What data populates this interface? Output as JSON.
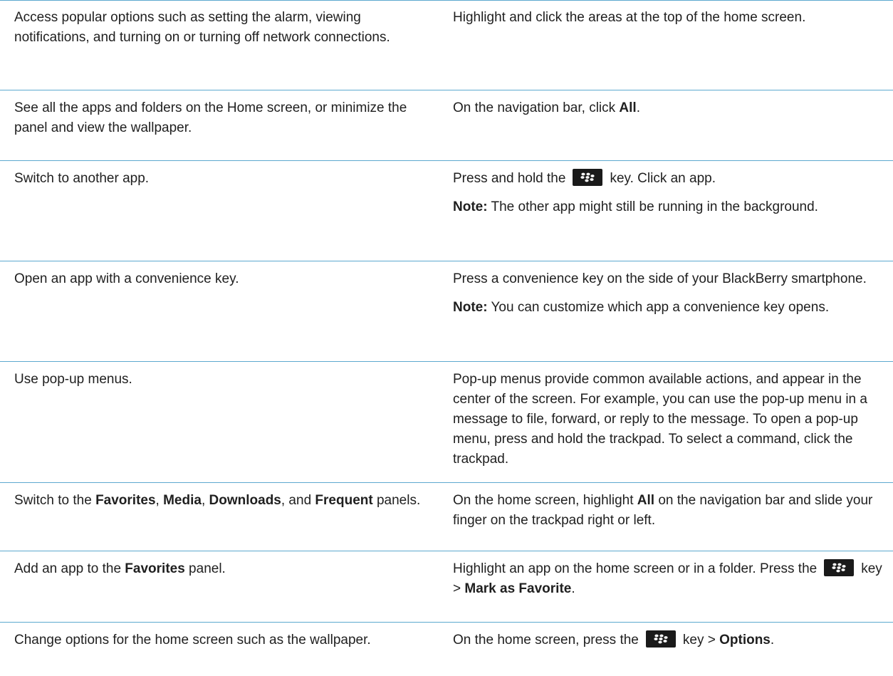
{
  "rows": [
    {
      "task": "Access popular options such as setting the alarm, viewing notifications, and turning on or turning off network connections.",
      "action": [
        [
          {
            "t": "Highlight and click the areas at the top of the home screen."
          }
        ]
      ]
    },
    {
      "task": "See all the apps and folders on the Home screen, or minimize the panel and view the wallpaper.",
      "action": [
        [
          {
            "t": "On the navigation bar, click "
          },
          {
            "t": "All",
            "b": true
          },
          {
            "t": "."
          }
        ]
      ]
    },
    {
      "task": "Switch to another app.",
      "action": [
        [
          {
            "t": "Press and hold the"
          },
          {
            "key": "blackberry-menu-key-icon"
          },
          {
            "t": "key. Click an app."
          }
        ],
        [
          {
            "t": "Note:",
            "b": true
          },
          {
            "t": " The other app might still be running in the background."
          }
        ]
      ]
    },
    {
      "task": "Open an app with a convenience key.",
      "action": [
        [
          {
            "t": "Press a convenience key on the side of your BlackBerry smartphone."
          }
        ],
        [
          {
            "t": "Note:",
            "b": true
          },
          {
            "t": " You can customize which app a convenience key opens."
          }
        ]
      ]
    },
    {
      "task": "Use pop-up menus.",
      "action": [
        [
          {
            "t": "Pop-up menus provide common available actions, and appear in the center of the screen. For example, you can use the pop-up menu in a message to file, forward, or reply to the message. To open a pop-up menu, press and hold the trackpad. To select a command, click the trackpad."
          }
        ]
      ]
    },
    {
      "task_parts": [
        {
          "t": "Switch to the "
        },
        {
          "t": "Favorites",
          "b": true
        },
        {
          "t": ", "
        },
        {
          "t": "Media",
          "b": true
        },
        {
          "t": ", "
        },
        {
          "t": "Downloads",
          "b": true
        },
        {
          "t": ", and "
        },
        {
          "t": "Frequent",
          "b": true
        },
        {
          "t": " panels."
        }
      ],
      "action": [
        [
          {
            "t": "On the home screen, highlight "
          },
          {
            "t": "All",
            "b": true
          },
          {
            "t": " on the navigation bar and slide your finger on the trackpad right or left."
          }
        ]
      ]
    },
    {
      "task_parts": [
        {
          "t": "Add an app to the "
        },
        {
          "t": "Favorites",
          "b": true
        },
        {
          "t": " panel."
        }
      ],
      "action": [
        [
          {
            "t": "Highlight an app on the home screen or in a folder. Press the"
          },
          {
            "key": "blackberry-menu-key-icon"
          },
          {
            "t": "key > "
          },
          {
            "t": "Mark as Favorite",
            "b": true
          },
          {
            "t": "."
          }
        ]
      ]
    },
    {
      "task": "Change options for the home screen such as the wallpaper.",
      "action": [
        [
          {
            "t": "On the home screen, press the"
          },
          {
            "key": "blackberry-menu-key-icon"
          },
          {
            "t": "key > "
          },
          {
            "t": "Options",
            "b": true
          },
          {
            "t": "."
          }
        ]
      ]
    }
  ],
  "colors": {
    "rule": "#5da9cf",
    "text": "#1f1f1f",
    "key_bg": "#1a1a1a"
  }
}
